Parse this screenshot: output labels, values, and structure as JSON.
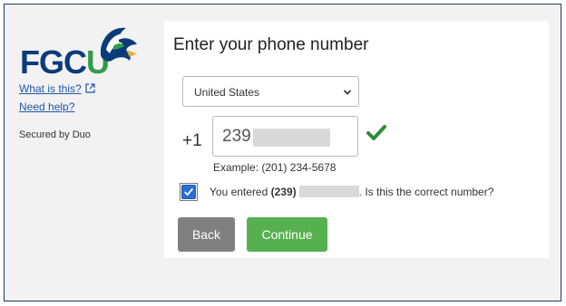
{
  "sidebar": {
    "logo_text_main": "FGC",
    "logo_text_accent": "U",
    "what_is_this": "What is this?",
    "need_help": "Need help?",
    "secured_by": "Secured by Duo"
  },
  "main": {
    "title": "Enter your phone number",
    "country_select": "United States",
    "country_code": "+1",
    "phone_value": "239",
    "example": "Example: (201) 234-5678",
    "confirm_prefix": "You entered",
    "confirm_number": "(239)",
    "confirm_suffix": ". Is this the correct number?",
    "confirm_checked": true,
    "back_label": "Back",
    "continue_label": "Continue"
  },
  "colors": {
    "brand_blue": "#0b3b7a",
    "brand_green": "#2e9e4a",
    "continue_green": "#56b04f",
    "back_gray": "#808080",
    "link_blue": "#1f57a8",
    "checkbox_blue": "#2b6dd1"
  },
  "icons": {
    "logo": "eagle-logo-icon",
    "external": "external-link-icon",
    "dropdown": "chevron-down-icon",
    "valid": "checkmark-icon",
    "checkbox": "checkbox-checked-icon"
  }
}
